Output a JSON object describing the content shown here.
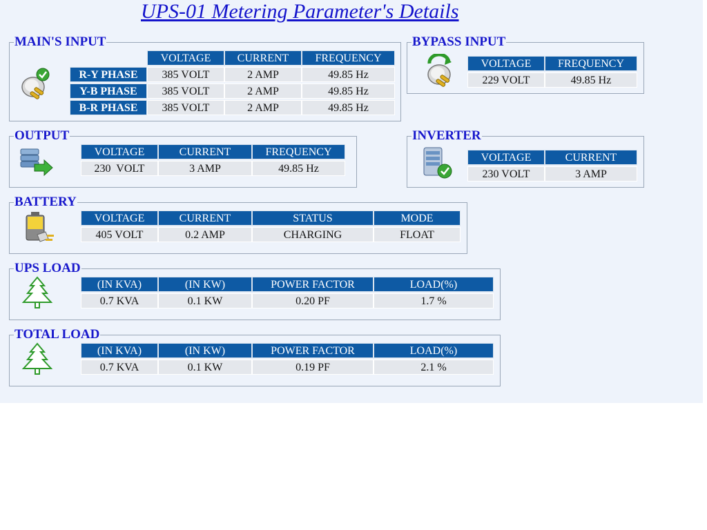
{
  "title": "UPS-01 Metering Parameter's Details",
  "mains": {
    "legend": "MAIN'S INPUT",
    "headers": [
      "VOLTAGE",
      "CURRENT",
      "FREQUENCY"
    ],
    "rows": [
      {
        "phase": "R-Y PHASE",
        "voltage": "385 VOLT",
        "current": "2 AMP",
        "frequency": "49.85 Hz"
      },
      {
        "phase": "Y-B PHASE",
        "voltage": "385 VOLT",
        "current": "2 AMP",
        "frequency": "49.85 Hz"
      },
      {
        "phase": "B-R PHASE",
        "voltage": "385 VOLT",
        "current": "2 AMP",
        "frequency": "49.85 Hz"
      }
    ]
  },
  "bypass": {
    "legend": "BYPASS INPUT",
    "headers": [
      "VOLTAGE",
      "FREQUENCY"
    ],
    "values": [
      "229 VOLT",
      "49.85 Hz"
    ]
  },
  "output": {
    "legend": "OUTPUT",
    "headers": [
      "VOLTAGE",
      "CURRENT",
      "FREQUENCY"
    ],
    "values": [
      "230  VOLT",
      "3 AMP",
      "49.85 Hz"
    ]
  },
  "inverter": {
    "legend": "INVERTER",
    "headers": [
      "VOLTAGE",
      "CURRENT"
    ],
    "values": [
      "230 VOLT",
      "3 AMP"
    ]
  },
  "battery": {
    "legend": "BATTERY",
    "headers": [
      "VOLTAGE",
      "CURRENT",
      "STATUS",
      "MODE"
    ],
    "values": [
      "405 VOLT",
      "0.2 AMP",
      "CHARGING",
      "FLOAT"
    ]
  },
  "ups_load": {
    "legend": "UPS LOAD",
    "headers": [
      "(IN KVA)",
      "(IN KW)",
      "POWER FACTOR",
      "LOAD(%)"
    ],
    "values": [
      "0.7 KVA",
      "0.1 KW",
      "0.20 PF",
      "1.7 %"
    ]
  },
  "total_load": {
    "legend": "TOTAL LOAD",
    "headers": [
      "(IN KVA)",
      "(IN KW)",
      "POWER FACTOR",
      "LOAD(%)"
    ],
    "values": [
      "0.7 KVA",
      "0.1 KW",
      "0.19 PF",
      "2.1 %"
    ]
  },
  "icons": {
    "mains": "plug-check-icon",
    "bypass": "plug-refresh-icon",
    "output": "server-arrow-icon",
    "inverter": "server-check-icon",
    "battery": "battery-plug-icon",
    "load": "tree-icon"
  },
  "colors": {
    "header_bg": "#0e5aa4",
    "legend_text": "#1818cc",
    "value_bg": "#e4e7ec",
    "page_bg": "#eef3fb"
  }
}
